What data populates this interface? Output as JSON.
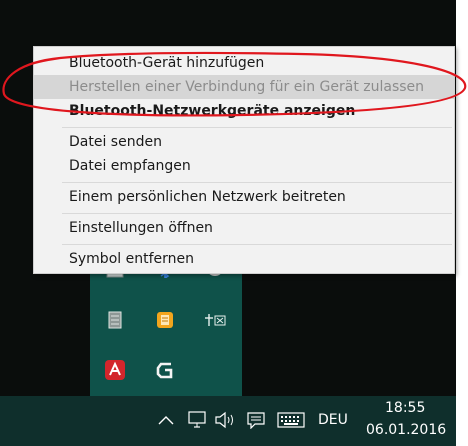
{
  "context_menu": {
    "items": [
      {
        "label": "Bluetooth-Gerät hinzufügen",
        "state": "normal"
      },
      {
        "label": "Herstellen einer Verbindung für ein Gerät zulassen",
        "state": "disabled"
      },
      {
        "label": "Bluetooth-Netzwerkgeräte anzeigen",
        "state": "default-bold"
      },
      {
        "label": "Datei senden",
        "state": "normal"
      },
      {
        "label": "Datei empfangen",
        "state": "normal"
      },
      {
        "label": "Einem persönlichen Netzwerk beitreten",
        "state": "normal"
      },
      {
        "label": "Einstellungen öffnen",
        "state": "normal"
      },
      {
        "label": "Symbol entfernen",
        "state": "normal"
      }
    ]
  },
  "tray_overflow": {
    "icons": [
      "tray-app-icon",
      "bluetooth-icon",
      "cd-drive-icon",
      "tablet-icon",
      "orange-app-icon",
      "network-disconnected-icon",
      "avira-icon",
      "logitech-g-icon"
    ]
  },
  "taskbar": {
    "language": "DEU",
    "time": "18:55",
    "date": "06.01.2016"
  },
  "annotation_color": "#e0171e"
}
